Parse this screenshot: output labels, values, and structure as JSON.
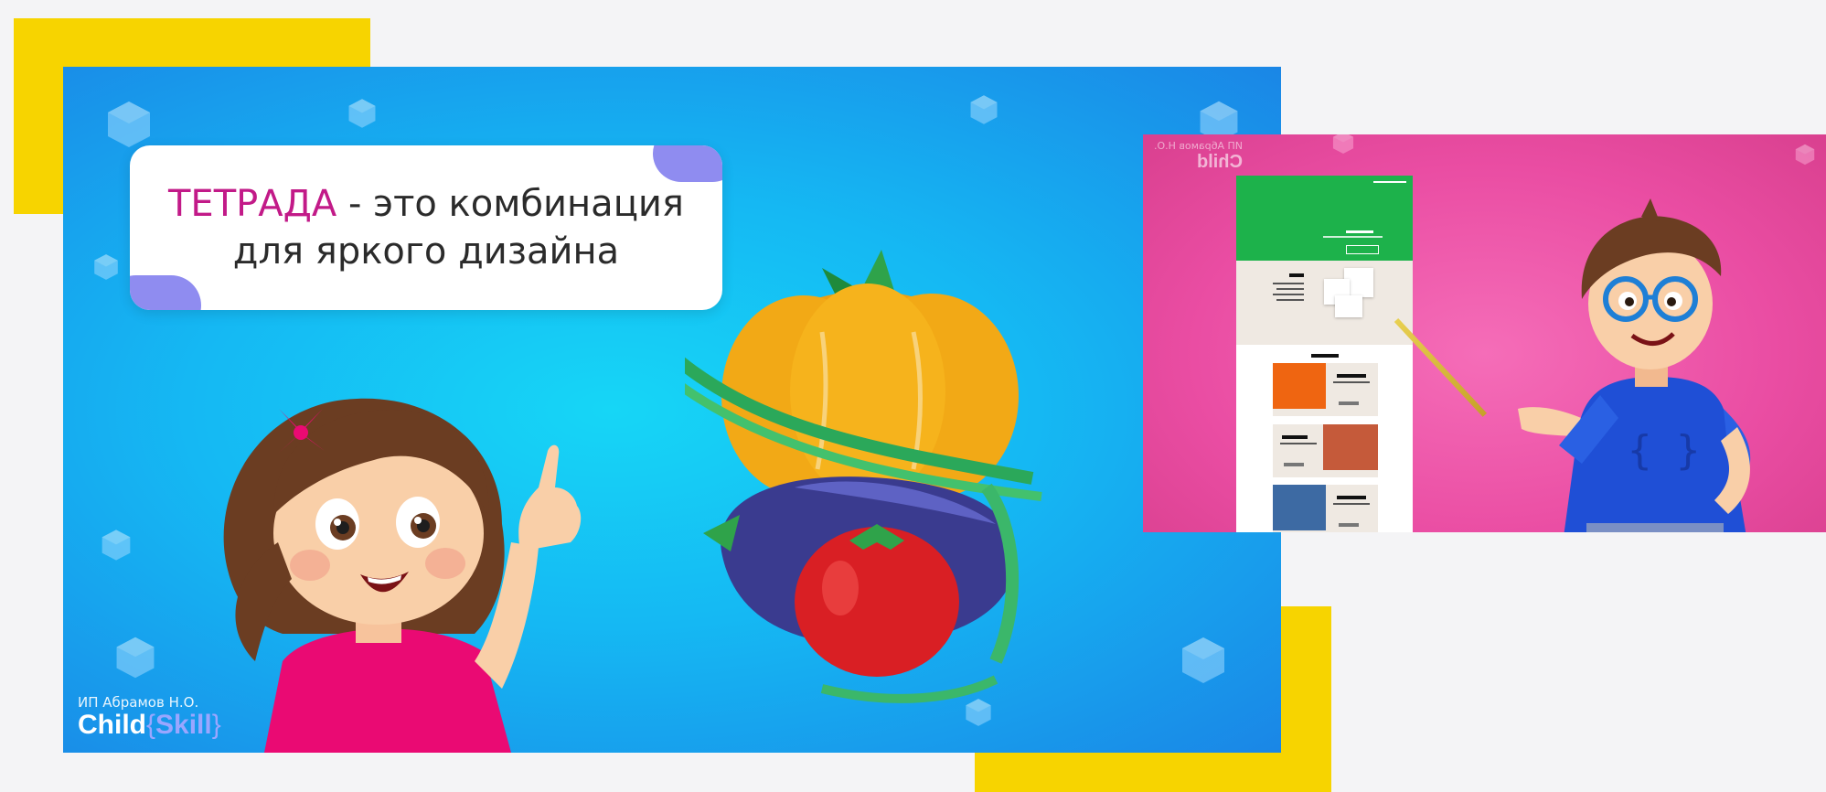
{
  "slide1": {
    "title": {
      "accent": "ТЕТРАДА",
      "rest": " - это комбинация",
      "line2": "для яркого дизайна"
    },
    "brand": {
      "sub": "ИП Абрамов Н.О.",
      "name": "Child",
      "name_accent": "Skill"
    }
  },
  "slide2": {
    "brand": {
      "sub": "ИП Абрамов Н.О.",
      "name": "Child"
    },
    "cards": [
      {
        "color": "#ef6511"
      },
      {
        "color": "#c55a3a"
      },
      {
        "color": "#3d6aa3"
      }
    ]
  },
  "colors": {
    "accent_yellow": "#f7d400",
    "slide1_bg": "#16c4f5",
    "slide2_bg": "#ea4da3",
    "title_accent": "#c21a88",
    "site_hero_green": "#1db24b"
  }
}
